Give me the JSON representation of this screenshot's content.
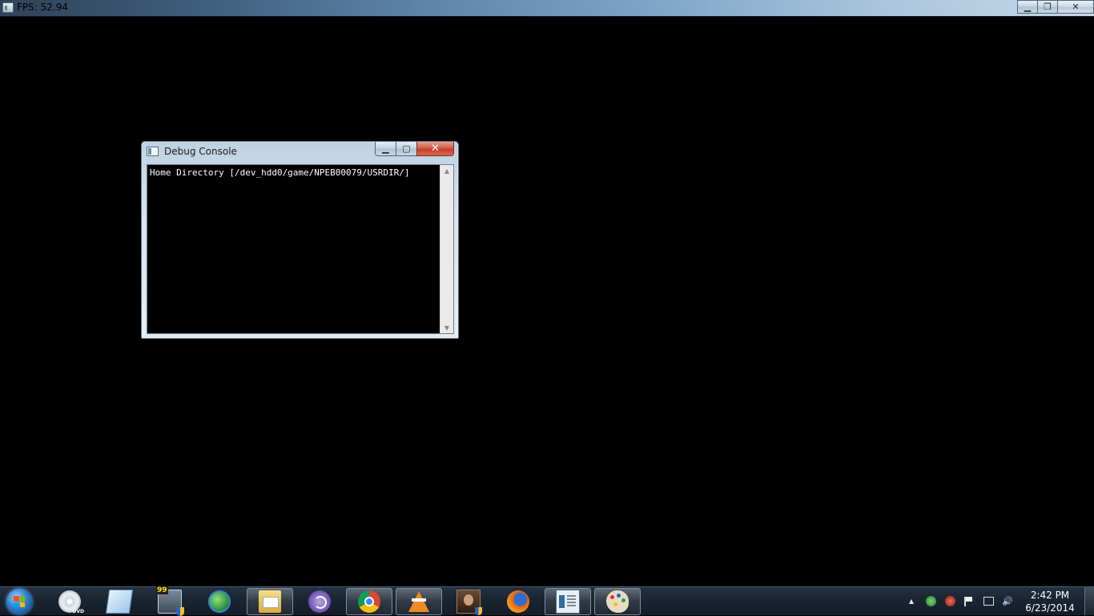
{
  "main_window": {
    "title": "FPS: 52.94",
    "controls": {
      "minimize": "▁",
      "maximize": "❐",
      "close": "✕"
    }
  },
  "debug_console": {
    "title": "Debug Console",
    "lines": [
      "Home Directory [/dev_hdd0/game/NPEB00079/USRDIR/]"
    ],
    "controls": {
      "minimize": "▁",
      "maximize": "▢",
      "close": "✕"
    },
    "scroll": {
      "up": "▲",
      "down": "▼"
    }
  },
  "taskbar": {
    "pinned": [
      {
        "name": "dvd-player",
        "icon": "dvd-icon",
        "dvd_label": "DVD",
        "active": false
      },
      {
        "name": "notepad",
        "icon": "notepad-icon",
        "active": false
      },
      {
        "name": "system-monitor",
        "icon": "monitor-icon",
        "badge": "99",
        "active": false
      },
      {
        "name": "internet-download-manager",
        "icon": "globe-icon",
        "active": false
      },
      {
        "name": "windows-explorer",
        "icon": "folder-icon",
        "active": true
      },
      {
        "name": "bittorrent",
        "icon": "torrent-icon",
        "active": false
      },
      {
        "name": "google-chrome",
        "icon": "chrome-icon",
        "active": true
      },
      {
        "name": "vlc-media-player",
        "icon": "vlc-icon",
        "active": true
      },
      {
        "name": "game-app",
        "icon": "avatar-icon",
        "active": false
      },
      {
        "name": "firefox",
        "icon": "firefox-icon",
        "active": false
      },
      {
        "name": "debug-console-app",
        "icon": "console-icon",
        "active": true
      },
      {
        "name": "paint",
        "icon": "palette-icon",
        "active": true
      }
    ],
    "tray": {
      "show_hidden": "▲",
      "volume": "🔊"
    },
    "clock": {
      "time": "2:42 PM",
      "date": "6/23/2014"
    }
  }
}
